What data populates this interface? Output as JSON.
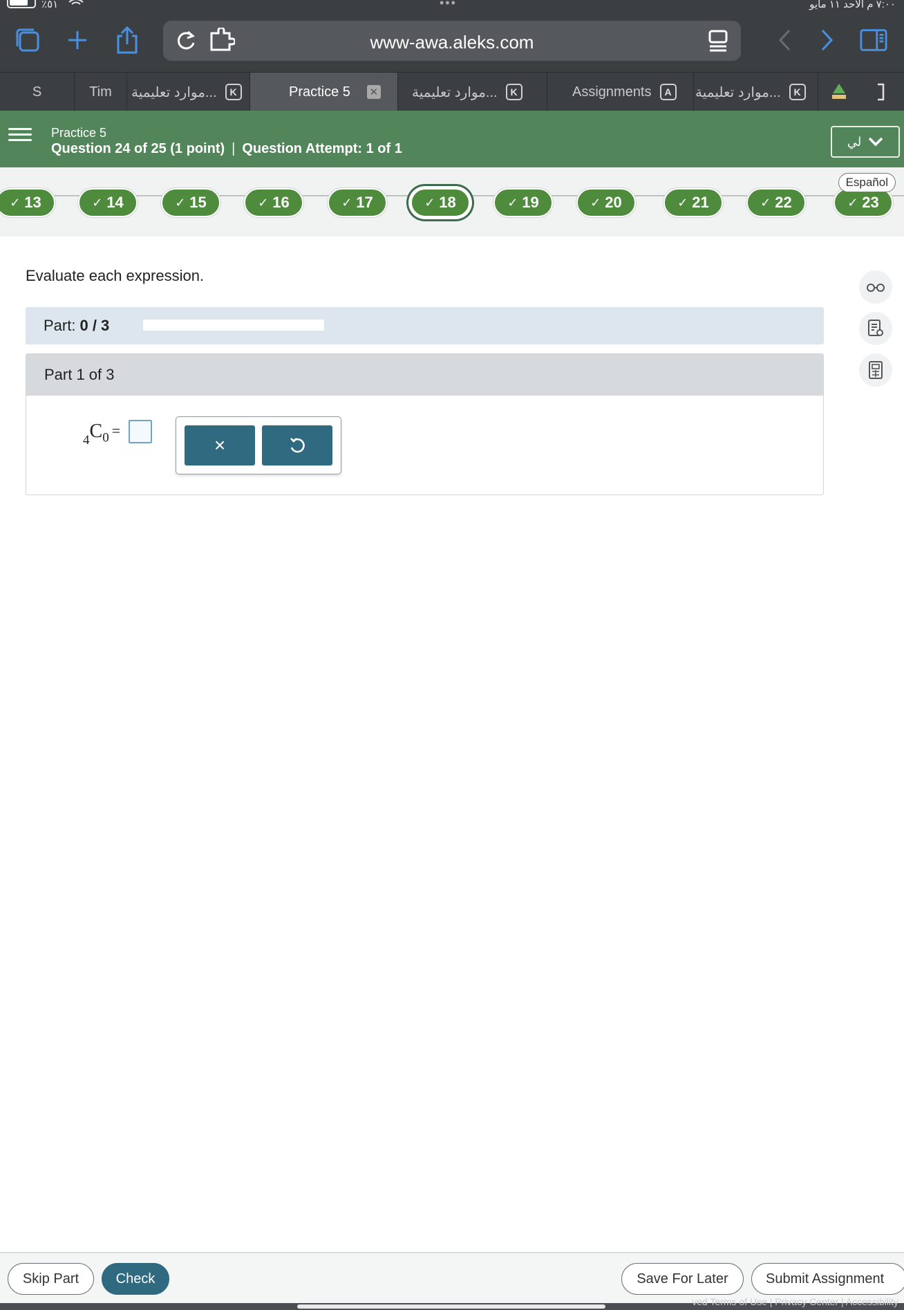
{
  "status_bar": {
    "battery": "٪٥١",
    "time": "٧:٠٠ م   الأحد ١١ مايو"
  },
  "browser": {
    "url": "www-awa.aleks.com",
    "tabs": [
      {
        "label": "S"
      },
      {
        "label": "Tim"
      },
      {
        "label": "موارد تعليمية...",
        "badge": "K"
      },
      {
        "label": "Practice 5",
        "badge": "✕"
      },
      {
        "label": "موارد تعليمية...",
        "badge": "K"
      },
      {
        "label": "Assignments",
        "badge": "A"
      },
      {
        "label": "موارد تعليمية...",
        "badge": "K"
      }
    ]
  },
  "header": {
    "assignment": "Practice 5",
    "question": "Question 24 of 25 (1 point)",
    "separator": "|",
    "attempt": "Question Attempt: 1 of 1",
    "language": "لي"
  },
  "question_nav": {
    "items": [
      "13",
      "14",
      "15",
      "16",
      "17",
      "18",
      "19",
      "20",
      "21",
      "22",
      "23"
    ],
    "current": "18",
    "espanol": "Español"
  },
  "content": {
    "prompt": "Evaluate each expression.",
    "part_label": "Part:",
    "part_value": "0 / 3",
    "part_progress": 0,
    "part_header": "Part 1 of 3",
    "expression": {
      "pre": "4",
      "base": "C",
      "sub": "0",
      "eq": "="
    }
  },
  "tools": {
    "clear": "×",
    "undo": "↺"
  },
  "footer": {
    "skip": "Skip Part",
    "check": "Check",
    "save": "Save For Later",
    "submit": "Submit Assignment",
    "legal": "ved   Terms of Use  |  Privacy Center  |  Accessibility"
  },
  "colors": {
    "header_green": "#52865a",
    "pill_green": "#4f8b3c",
    "primary_blue": "#2f6a80"
  }
}
